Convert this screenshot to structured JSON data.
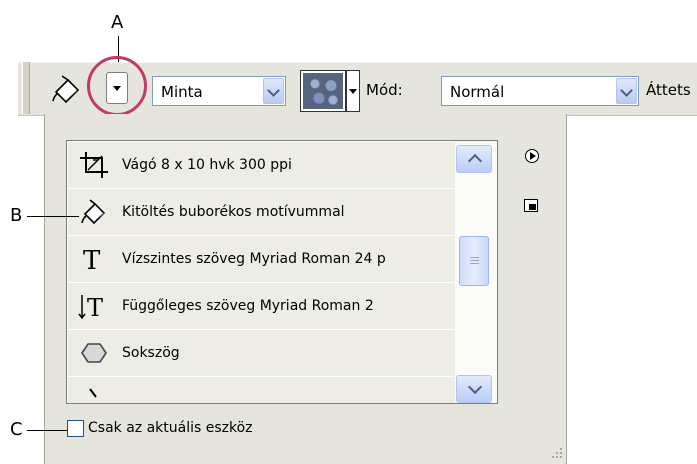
{
  "callouts": {
    "a": "A",
    "b": "B",
    "c": "C"
  },
  "optionsbar": {
    "mode_select_value": "Minta",
    "mod_label": "Mód:",
    "blend_select_value": "Normál",
    "opacity_label_partial": "Áttets"
  },
  "presets": {
    "items": [
      {
        "label": "Vágó 8 x 10 hvk 300 ppi",
        "icon": "crop-icon"
      },
      {
        "label": "Kitöltés buborékos motívummal",
        "icon": "paint-bucket-icon"
      },
      {
        "label": "Vízszintes szöveg Myriad Roman 24 p",
        "icon": "horizontal-type-icon"
      },
      {
        "label": "Függőleges szöveg Myriad Roman 2",
        "icon": "vertical-type-icon"
      },
      {
        "label": "Sokszög",
        "icon": "polygon-icon"
      },
      {
        "label": "",
        "icon": "partial-item-icon"
      }
    ],
    "current_tool_only_label": "Csak az aktuális eszköz",
    "current_tool_only_checked": false
  },
  "colors": {
    "ring": "#c23a6a",
    "panel_bg": "#e6e5dd",
    "row_bg": "#edece5",
    "xp_blue": "#b9cdf7"
  }
}
